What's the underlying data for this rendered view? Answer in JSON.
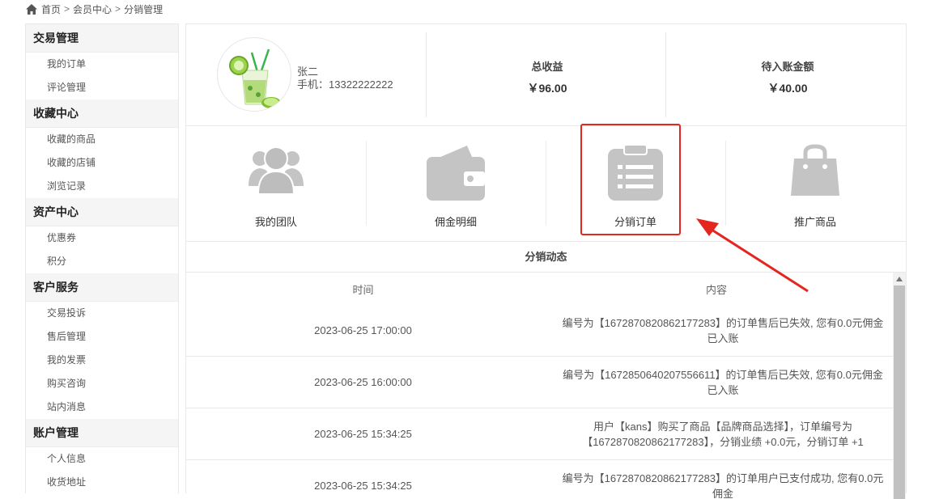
{
  "breadcrumb": {
    "home": "首页",
    "sep1": ">",
    "member": "会员中心",
    "sep2": ">",
    "current": "分销管理"
  },
  "sidebar": {
    "groups": [
      {
        "title": "交易管理",
        "items": [
          "我的订单",
          "评论管理"
        ]
      },
      {
        "title": "收藏中心",
        "items": [
          "收藏的商品",
          "收藏的店铺",
          "浏览记录"
        ]
      },
      {
        "title": "资产中心",
        "items": [
          "优惠券",
          "积分"
        ]
      },
      {
        "title": "客户服务",
        "items": [
          "交易投诉",
          "售后管理",
          "我的发票",
          "购买咨询",
          "站内消息"
        ]
      },
      {
        "title": "账户管理",
        "items": [
          "个人信息",
          "收货地址"
        ]
      }
    ]
  },
  "user": {
    "name": "张二",
    "phone_label": "手机：",
    "phone": "13322222222"
  },
  "stats": {
    "total_label": "总收益",
    "total_value": "￥96.00",
    "pending_label": "待入账金额",
    "pending_value": "￥40.00"
  },
  "features": [
    {
      "label": "我的团队",
      "icon": "team-icon"
    },
    {
      "label": "佣金明细",
      "icon": "wallet-icon"
    },
    {
      "label": "分销订单",
      "icon": "clipboard-icon"
    },
    {
      "label": "推广商品",
      "icon": "shopping-bag-icon"
    }
  ],
  "annotation": {
    "highlight_color": "#e5261f"
  },
  "dynamics": {
    "title": "分销动态",
    "headers": {
      "time": "时间",
      "content": "内容"
    },
    "rows": [
      {
        "time": "2023-06-25 17:00:00",
        "content": "编号为【1672870820862177283】的订单售后已失效, 您有0.0元佣金已入账"
      },
      {
        "time": "2023-06-25 16:00:00",
        "content": "编号为【1672850640207556611】的订单售后已失效, 您有0.0元佣金已入账"
      },
      {
        "time": "2023-06-25 15:34:25",
        "content": "用户【kans】购买了商品【品牌商品选择】，订单编号为【1672870820862177283】，分销业绩 +0.0元，分销订单 +1"
      },
      {
        "time": "2023-06-25 15:34:25",
        "content": "编号为【1672870820862177283】的订单用户已支付成功, 您有0.0元佣金"
      }
    ]
  }
}
